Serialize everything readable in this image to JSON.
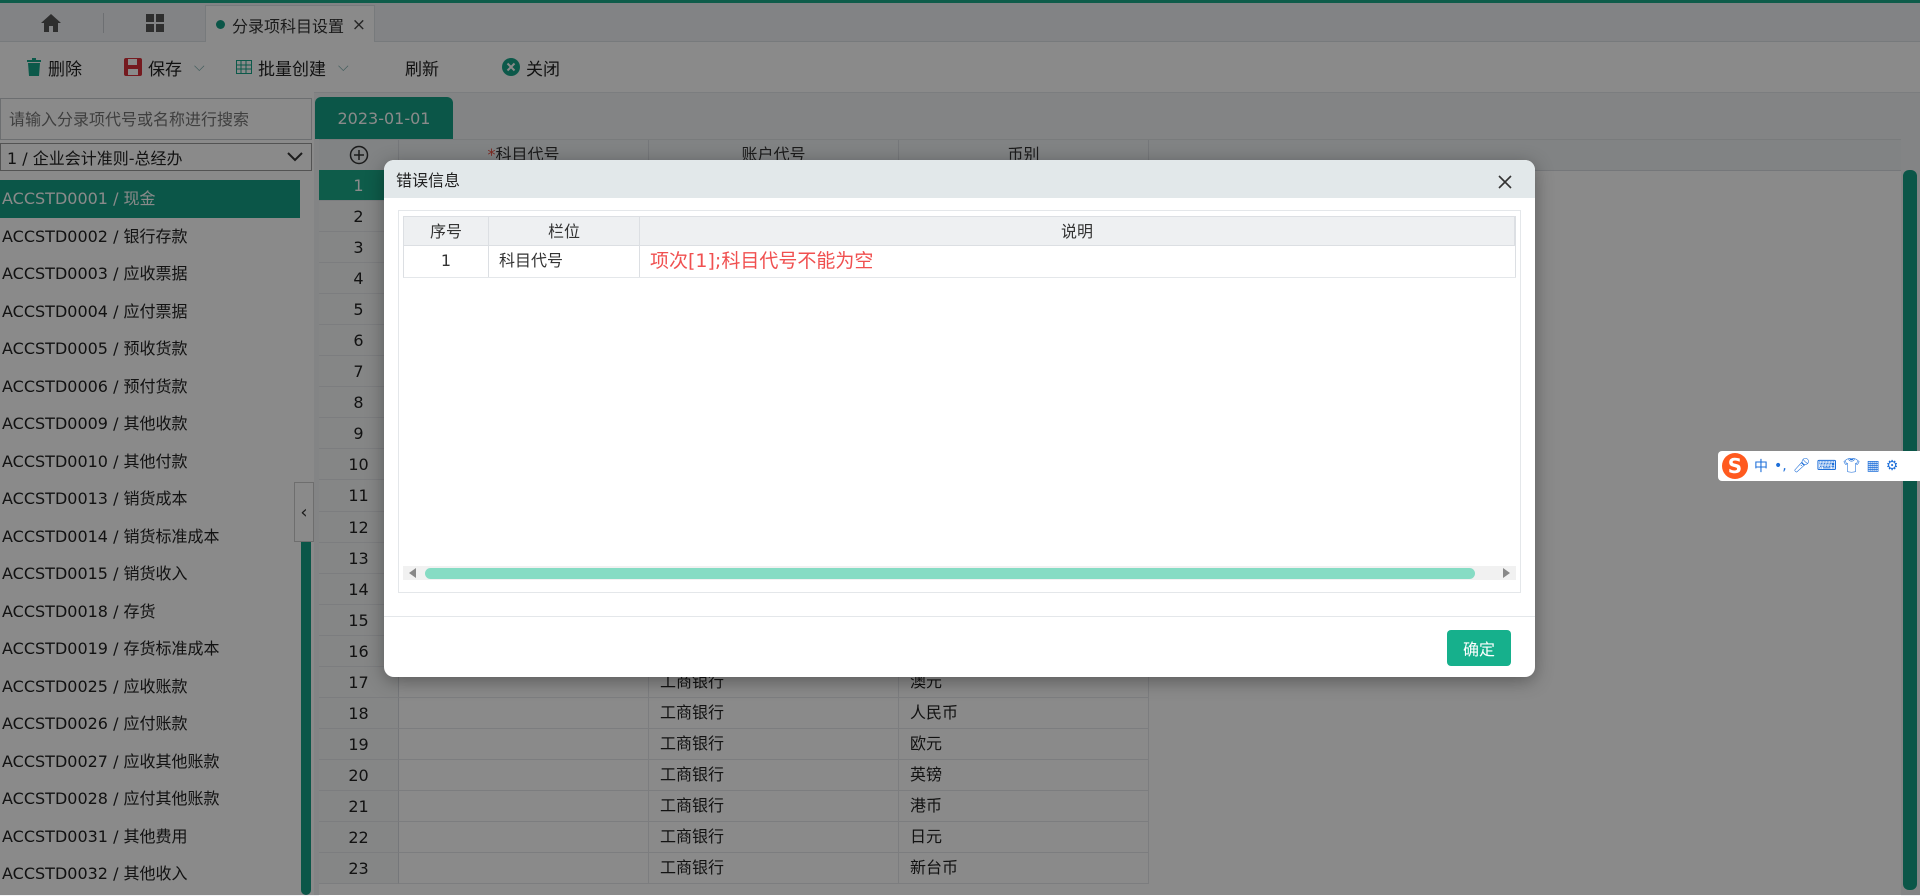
{
  "top_tab": {
    "label": "分录项科目设置",
    "close": "×"
  },
  "toolbar": {
    "delete_label": "删除",
    "save_label": "保存",
    "batch_create_label": "批量创建",
    "refresh_label": "刷新",
    "close_label": "关闭"
  },
  "left": {
    "search_placeholder": "请输入分录项代号或名称进行搜索",
    "standard_select": "1 / 企业会计准则-总经办",
    "items": [
      "ACCSTD0001 / 现金",
      "ACCSTD0002 / 银行存款",
      "ACCSTD0003 / 应收票据",
      "ACCSTD0004 / 应付票据",
      "ACCSTD0005 / 预收货款",
      "ACCSTD0006 / 预付货款",
      "ACCSTD0009 / 其他收款",
      "ACCSTD0010 / 其他付款",
      "ACCSTD0013 / 销货成本",
      "ACCSTD0014 / 销货标准成本",
      "ACCSTD0015 / 销货收入",
      "ACCSTD0018 / 存货",
      "ACCSTD0019 / 存货标准成本",
      "ACCSTD0025 / 应收账款",
      "ACCSTD0026 / 应付账款",
      "ACCSTD0027 / 应收其他账款",
      "ACCSTD0028 / 应付其他账款",
      "ACCSTD0031 / 其他费用",
      "ACCSTD0032 / 其他收入"
    ]
  },
  "grid": {
    "date_tab": "2023-01-01",
    "headers": {
      "subject_code": "科目代号",
      "required_mark": "*",
      "account_code": "账户代号",
      "currency": "币别"
    },
    "row_numbers": [
      "1",
      "2",
      "3",
      "4",
      "5",
      "6",
      "7",
      "8",
      "9",
      "10",
      "11",
      "12",
      "13",
      "14",
      "15",
      "16",
      "17",
      "18",
      "19",
      "20",
      "21",
      "22",
      "23"
    ],
    "visible_rows": [
      {
        "num": "17",
        "account": "工商银行",
        "currency": "澳元"
      },
      {
        "num": "18",
        "account": "工商银行",
        "currency": "人民币"
      },
      {
        "num": "19",
        "account": "工商银行",
        "currency": "欧元"
      },
      {
        "num": "20",
        "account": "工商银行",
        "currency": "英镑"
      },
      {
        "num": "21",
        "account": "工商银行",
        "currency": "港币"
      },
      {
        "num": "22",
        "account": "工商银行",
        "currency": "日元"
      },
      {
        "num": "23",
        "account": "工商银行",
        "currency": "新台币"
      }
    ]
  },
  "dialog": {
    "title": "错误信息",
    "columns": {
      "seq": "序号",
      "field": "栏位",
      "desc": "说明"
    },
    "rows": [
      {
        "seq": "1",
        "field": "科目代号",
        "desc": "项次[1];科目代号不能为空"
      }
    ],
    "ok_label": "确定"
  },
  "ime": {
    "logo": "S",
    "lang": "中"
  },
  "colors": {
    "accent": "#16a085",
    "error_text": "#f05050"
  }
}
